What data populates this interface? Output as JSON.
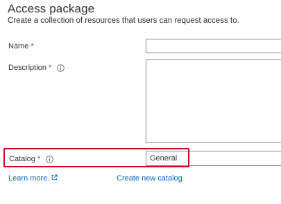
{
  "header": {
    "title": "Access package",
    "subtitle": "Create a collection of resources that users can request access to."
  },
  "form": {
    "name_label": "Name",
    "description_label": "Description",
    "catalog_label": "Catalog",
    "required_marker": "*",
    "name_value": "",
    "description_value": "",
    "catalog_value": "General"
  },
  "links": {
    "learn_more": "Learn more.",
    "create_catalog": "Create new catalog"
  },
  "colors": {
    "required": "#a4262c",
    "link": "#0067b8",
    "highlight": "#d0021b",
    "border": "#8a8886"
  },
  "icons": {
    "info": "info-icon",
    "external_link": "external-link-icon"
  }
}
